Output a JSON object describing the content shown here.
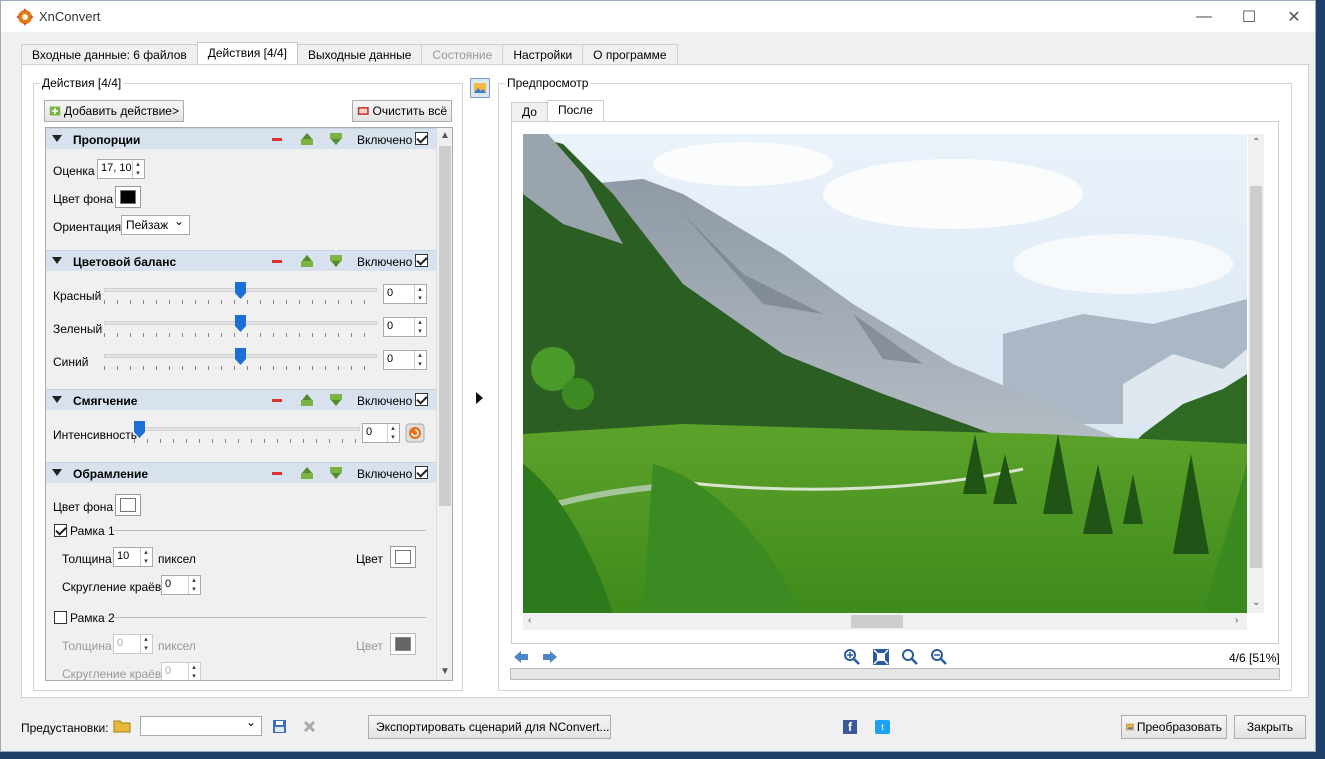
{
  "window": {
    "title": "XnConvert",
    "minimize": "—",
    "maximize": "☐",
    "close": "✕"
  },
  "tabs": [
    {
      "label": "Входные данные: 6 файлов",
      "state": "normal"
    },
    {
      "label": "Действия [4/4]",
      "state": "active"
    },
    {
      "label": "Выходные данные",
      "state": "normal"
    },
    {
      "label": "Состояние",
      "state": "disabled"
    },
    {
      "label": "Настройки",
      "state": "normal"
    },
    {
      "label": "О программе",
      "state": "normal"
    }
  ],
  "actions_panel": {
    "group_title": "Действия [4/4]",
    "add_button": "Добавить действие>",
    "clear_button": "Очистить всё",
    "enabled_label": "Включено",
    "sections": {
      "proportions": {
        "title": "Пропорции",
        "ratio_label": "Оценка",
        "ratio_value": "17, 10",
        "bg_label": "Цвет фона",
        "bg_color": "#000000",
        "orientation_label": "Ориентация",
        "orientation_value": "Пейзаж"
      },
      "color_balance": {
        "title": "Цветовой баланс",
        "red_label": "Красный",
        "red_value": "0",
        "green_label": "Зеленый",
        "green_value": "0",
        "blue_label": "Синий",
        "blue_value": "0"
      },
      "smoothing": {
        "title": "Смягчение",
        "intensity_label": "Интенсивность",
        "intensity_value": "0"
      },
      "framing": {
        "title": "Обрамление",
        "bg_label": "Цвет фона",
        "bg_color": "#ffffff",
        "frame1_label": "Рамка 1",
        "frame1_checked": true,
        "thickness_label": "Толщина",
        "frame1_thickness": "10",
        "pixels_label": "пиксел",
        "color_label": "Цвет",
        "frame1_color": "#ffffff",
        "rounding_label": "Скругление краёв",
        "frame1_rounding": "0",
        "frame2_label": "Рамка 2",
        "frame2_checked": false,
        "frame2_thickness": "0",
        "frame2_color": "#666666",
        "frame2_rounding": "0"
      }
    }
  },
  "preview": {
    "group_title": "Предпросмотр",
    "tab_before": "До",
    "tab_after": "После",
    "counter": "4/6 [51%]"
  },
  "bottom": {
    "presets_label": "Предустановки:",
    "preset_value": "",
    "export_button": "Экспортировать сценарий для NConvert...",
    "convert_button": "Преобразовать",
    "close_button": "Закрыть",
    "facebook_glyph": "f",
    "twitter_glyph": "t"
  }
}
